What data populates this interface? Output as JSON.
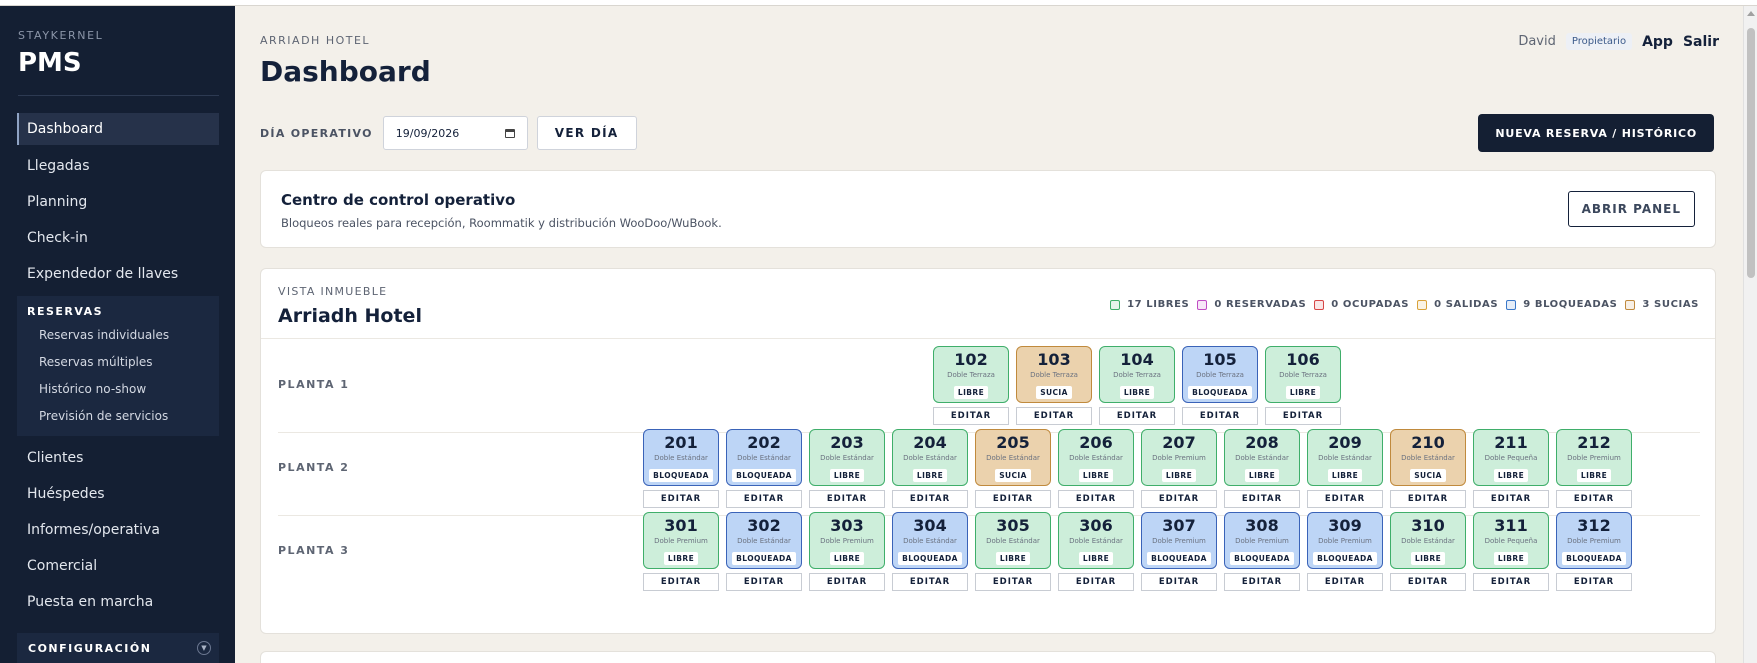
{
  "sidebar": {
    "brand_sub": "STAYKERNEL",
    "brand": "PMS",
    "items_top": [
      "Dashboard",
      "Llegadas",
      "Planning",
      "Check-in",
      "Expendedor de llaves"
    ],
    "reservas_title": "RESERVAS",
    "reservas_items": [
      "Reservas individuales",
      "Reservas múltiples",
      "Histórico no-show",
      "Previsión de servicios"
    ],
    "items_bottom": [
      "Clientes",
      "Huéspedes",
      "Informes/operativa",
      "Comercial",
      "Puesta en marcha"
    ],
    "config_label": "CONFIGURACIÓN"
  },
  "header": {
    "hotel_sub": "ARRIADH HOTEL",
    "title": "Dashboard",
    "user_name": "David",
    "user_role": "Propietario",
    "app_link": "App",
    "logout_link": "Salir"
  },
  "day": {
    "label": "DÍA OPERATIVO",
    "date": "19/09/2026",
    "view_button": "VER DÍA",
    "new_button": "NUEVA RESERVA / HISTÓRICO"
  },
  "control": {
    "title": "Centro de control operativo",
    "desc": "Bloqueos reales para recepción, Roommatik y distribución WooDoo/WuBook.",
    "button": "ABRIR PANEL"
  },
  "property": {
    "sub": "VISTA INMUEBLE",
    "title": "Arriadh Hotel",
    "legend": [
      {
        "label": "17 LIBRES",
        "color": "#3fae6a"
      },
      {
        "label": "0 RESERVADAS",
        "color": "#c04cc4"
      },
      {
        "label": "0 OCUPADAS",
        "color": "#d64545"
      },
      {
        "label": "0 SALIDAS",
        "color": "#d9a23a"
      },
      {
        "label": "9 BLOQUEADAS",
        "color": "#3a78c9"
      },
      {
        "label": "3 SUCIAS",
        "color": "#c08a3d"
      }
    ],
    "edit_label": "EDITAR",
    "floors": [
      {
        "label": "PLANTA 1",
        "rooms": [
          {
            "num": "102",
            "type": "Doble Terraza",
            "status": "LIBRE",
            "state": "libre"
          },
          {
            "num": "103",
            "type": "Doble Terraza",
            "status": "SUCIA",
            "state": "sucia"
          },
          {
            "num": "104",
            "type": "Doble Terraza",
            "status": "LIBRE",
            "state": "libre"
          },
          {
            "num": "105",
            "type": "Doble Terraza",
            "status": "BLOQUEADA",
            "state": "bloq"
          },
          {
            "num": "106",
            "type": "Doble Terraza",
            "status": "LIBRE",
            "state": "libre"
          }
        ]
      },
      {
        "label": "PLANTA 2",
        "rooms": [
          {
            "num": "201",
            "type": "Doble Estándar",
            "status": "BLOQUEADA",
            "state": "bloq"
          },
          {
            "num": "202",
            "type": "Doble Estándar",
            "status": "BLOQUEADA",
            "state": "bloq"
          },
          {
            "num": "203",
            "type": "Doble Estándar",
            "status": "LIBRE",
            "state": "libre"
          },
          {
            "num": "204",
            "type": "Doble Estándar",
            "status": "LIBRE",
            "state": "libre"
          },
          {
            "num": "205",
            "type": "Doble Estándar",
            "status": "SUCIA",
            "state": "sucia"
          },
          {
            "num": "206",
            "type": "Doble Estándar",
            "status": "LIBRE",
            "state": "libre"
          },
          {
            "num": "207",
            "type": "Doble Premium",
            "status": "LIBRE",
            "state": "libre"
          },
          {
            "num": "208",
            "type": "Doble Estándar",
            "status": "LIBRE",
            "state": "libre"
          },
          {
            "num": "209",
            "type": "Doble Estándar",
            "status": "LIBRE",
            "state": "libre"
          },
          {
            "num": "210",
            "type": "Doble Estándar",
            "status": "SUCIA",
            "state": "sucia"
          },
          {
            "num": "211",
            "type": "Doble Pequeña",
            "status": "LIBRE",
            "state": "libre"
          },
          {
            "num": "212",
            "type": "Doble Premium",
            "status": "LIBRE",
            "state": "libre"
          }
        ]
      },
      {
        "label": "PLANTA 3",
        "rooms": [
          {
            "num": "301",
            "type": "Doble Premium",
            "status": "LIBRE",
            "state": "libre"
          },
          {
            "num": "302",
            "type": "Doble Estándar",
            "status": "BLOQUEADA",
            "state": "bloq"
          },
          {
            "num": "303",
            "type": "Doble Premium",
            "status": "LIBRE",
            "state": "libre"
          },
          {
            "num": "304",
            "type": "Doble Estándar",
            "status": "BLOQUEADA",
            "state": "bloq"
          },
          {
            "num": "305",
            "type": "Doble Estándar",
            "status": "LIBRE",
            "state": "libre"
          },
          {
            "num": "306",
            "type": "Doble Estándar",
            "status": "LIBRE",
            "state": "libre"
          },
          {
            "num": "307",
            "type": "Doble Premium",
            "status": "BLOQUEADA",
            "state": "bloq"
          },
          {
            "num": "308",
            "type": "Doble Premium",
            "status": "BLOQUEADA",
            "state": "bloq"
          },
          {
            "num": "309",
            "type": "Doble Premium",
            "status": "BLOQUEADA",
            "state": "bloq"
          },
          {
            "num": "310",
            "type": "Doble Estándar",
            "status": "LIBRE",
            "state": "libre"
          },
          {
            "num": "311",
            "type": "Doble Pequeña",
            "status": "LIBRE",
            "state": "libre"
          },
          {
            "num": "312",
            "type": "Doble Premium",
            "status": "BLOQUEADA",
            "state": "bloq"
          }
        ]
      }
    ]
  }
}
